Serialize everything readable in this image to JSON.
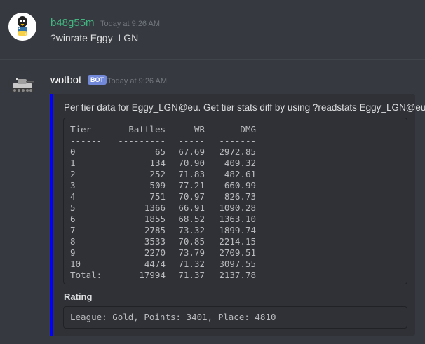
{
  "messages": [
    {
      "author": "b48g55m",
      "timestamp": "Today at 9:26 AM",
      "text": "?winrate Eggy_LGN",
      "author_color": "#43b581"
    },
    {
      "author": "wotbot",
      "bot_tag": "BOT",
      "timestamp": "Today at 9:26 AM",
      "embed": {
        "accent_color": "#0000ff",
        "description": "Per tier data for Eggy_LGN@eu. Get tier stats diff by using ?readstats Eggy_LGN@eu",
        "table": {
          "headers": [
            "Tier",
            "Battles",
            "WR",
            "DMG"
          ],
          "separators": [
            "------",
            "---------",
            "-----",
            "-------"
          ],
          "rows": [
            [
              "0",
              "65",
              "67.69",
              "2972.85"
            ],
            [
              "1",
              "134",
              "70.90",
              "409.32"
            ],
            [
              "2",
              "252",
              "71.83",
              "482.61"
            ],
            [
              "3",
              "509",
              "77.21",
              "660.99"
            ],
            [
              "4",
              "751",
              "70.97",
              "826.73"
            ],
            [
              "5",
              "1366",
              "66.91",
              "1090.28"
            ],
            [
              "6",
              "1855",
              "68.52",
              "1363.10"
            ],
            [
              "7",
              "2785",
              "73.32",
              "1899.74"
            ],
            [
              "8",
              "3533",
              "70.85",
              "2214.15"
            ],
            [
              "9",
              "2270",
              "73.79",
              "2709.51"
            ],
            [
              "10",
              "4474",
              "71.32",
              "3097.55"
            ],
            [
              "Total:",
              "17994",
              "71.37",
              "2137.78"
            ]
          ]
        },
        "field": {
          "name": "Rating",
          "value": "League: Gold, Points: 3401, Place: 4810"
        }
      }
    }
  ],
  "icons": {
    "user_avatar": "penguin-python-avatar-icon",
    "bot_avatar": "tank-avatar-icon"
  }
}
